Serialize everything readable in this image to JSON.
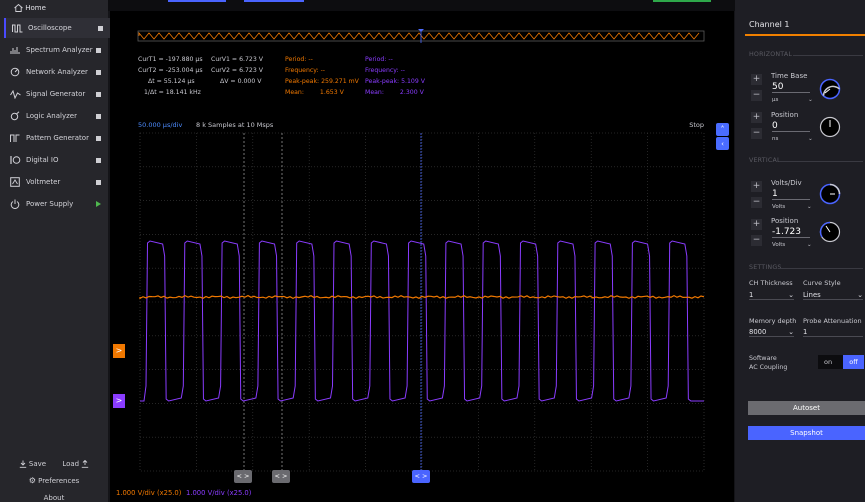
{
  "sidebar": {
    "home": "Home",
    "items": [
      {
        "label": "Oscilloscope",
        "icon": "oscilloscope-icon",
        "indicator": "square"
      },
      {
        "label": "Spectrum Analyzer",
        "icon": "spectrum-icon",
        "indicator": "square"
      },
      {
        "label": "Network Analyzer",
        "icon": "network-icon",
        "indicator": "square"
      },
      {
        "label": "Signal Generator",
        "icon": "signal-generator-icon",
        "indicator": "square"
      },
      {
        "label": "Logic Analyzer",
        "icon": "logic-analyzer-icon",
        "indicator": "square"
      },
      {
        "label": "Pattern Generator",
        "icon": "pattern-generator-icon",
        "indicator": "square"
      },
      {
        "label": "Digital IO",
        "icon": "digital-io-icon",
        "indicator": "square"
      },
      {
        "label": "Voltmeter",
        "icon": "voltmeter-icon",
        "indicator": "square"
      },
      {
        "label": "Power Supply",
        "icon": "power-supply-icon",
        "indicator": "play"
      }
    ],
    "save": "Save",
    "load": "Load",
    "preferences": "Preferences",
    "about": "About"
  },
  "cursors": {
    "curt1": "CurT1 = -197.880 µs",
    "curt2": "CurT2 = -253.004 µs",
    "dt": "Δt = 55.124 µs",
    "inv_dt": "1/Δt = 18.141 kHz",
    "curv1": "CurV1 = 6.723 V",
    "curv2": "CurV2 = 6.723 V",
    "dv": "ΔV = 0.000 V"
  },
  "measure_ch1": {
    "period_label": "Period:",
    "period": "--",
    "frequency_label": "Frequency:",
    "frequency": "--",
    "peak_label": "Peak-peak:",
    "peak": "259.271 mV",
    "mean_label": "Mean:",
    "mean": "1.653 V"
  },
  "measure_ch2": {
    "period_label": "Period:",
    "period": "--",
    "frequency_label": "Frequency:",
    "frequency": "--",
    "peak_label": "Peak-peak:",
    "peak": "5.109 V",
    "mean_label": "Mean:",
    "mean": "2.300 V"
  },
  "plot": {
    "timebase": "50.000 µs/div",
    "samples": "8 k Samples at 10 Msps",
    "status": "Stop",
    "ch1_scale": "1.000 V/div (x25.0)",
    "ch2_scale": "1.000 V/div (x25.0)",
    "cursor_btn_label": "< >",
    "trigger_icon": "chevron-up-icon",
    "ch1_marker": ">",
    "ch2_marker": ">"
  },
  "panel": {
    "channel_title": "Channel 1",
    "horizontal": "HORIZONTAL",
    "time_base_label": "Time Base",
    "time_base_value": "50",
    "time_base_unit": "µs",
    "position_label": "Position",
    "position_value": "0",
    "position_unit": "ns",
    "vertical": "VERTICAL",
    "volts_div_label": "Volts/Div",
    "volts_div_value": "1",
    "volts_div_unit": "Volts",
    "v_position_label": "Position",
    "v_position_value": "-1.723",
    "v_position_unit": "Volts",
    "settings": "SETTINGS",
    "ch_thickness_label": "CH Thickness",
    "ch_thickness_value": "1",
    "curve_style_label": "Curve Style",
    "curve_style_value": "Lines",
    "memory_depth_label": "Memory depth",
    "memory_depth_value": "8000",
    "probe_att_label": "Probe Attenuation",
    "probe_att_value": "1",
    "sw_ac_label_1": "Software",
    "sw_ac_label_2": "AC Coupling",
    "toggle_on": "on",
    "toggle_off": "off",
    "autoset": "Autoset",
    "snapshot": "Snapshot"
  },
  "colors": {
    "ch1": "#f07800",
    "ch2": "#8a3cff",
    "accent": "#4a64ff",
    "cursor": "#4d6cff"
  }
}
